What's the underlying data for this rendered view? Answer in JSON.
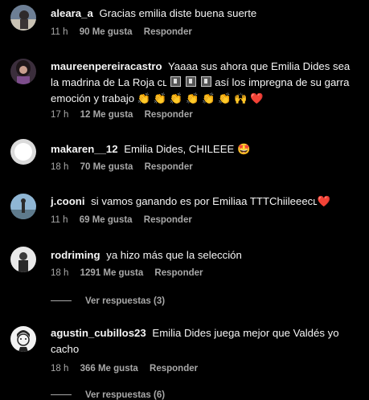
{
  "comments": [
    {
      "username": "aleara_a",
      "text": "Gracias emilia diste buena suerte",
      "time": "11 h",
      "likes": "90 Me gusta",
      "reply": "Responder"
    },
    {
      "username": "maureenpereiracastro",
      "text_a": "Yaaaa sus ahora que Emilia Dides sea la madrina de La Roja ᴄʟ",
      "text_b": "así los impregna de su garra emoción y trabajo 👏 👏 👏 👏 👏 👏 🙌 ❤️",
      "time": "17 h",
      "likes": "12 Me gusta",
      "reply": "Responder"
    },
    {
      "username": "makaren__12",
      "text": "Emilia Dides, CHILEEE 🤩",
      "time": "18 h",
      "likes": "70 Me gusta",
      "reply": "Responder"
    },
    {
      "username": "j.cooni",
      "text": "si vamos ganando es por Emiliaa TTTChiileeeᴄʟ❤️",
      "time": "11 h",
      "likes": "69 Me gusta",
      "reply": "Responder"
    },
    {
      "username": "rodriming",
      "text": "ya hizo más que la selección",
      "time": "18 h",
      "likes": "1291 Me gusta",
      "reply": "Responder",
      "view_replies": "Ver respuestas (3)"
    },
    {
      "username": "agustin_cubillos23",
      "text": "Emilia Dides juega mejor que Valdés yo cacho",
      "time": "18 h",
      "likes": "366 Me gusta",
      "reply": "Responder",
      "view_replies": "Ver respuestas (6)"
    }
  ],
  "icons": {
    "avatar_1": "profile-photo-icon",
    "avatar_2": "profile-photo-icon",
    "avatar_3": "default-profile-icon",
    "avatar_4": "profile-photo-icon",
    "avatar_5": "profile-photo-icon",
    "avatar_6": "profile-photo-icon"
  },
  "colors": {
    "background": "#000000",
    "text": "#f5f5f5",
    "secondary": "#a8a8a8"
  }
}
